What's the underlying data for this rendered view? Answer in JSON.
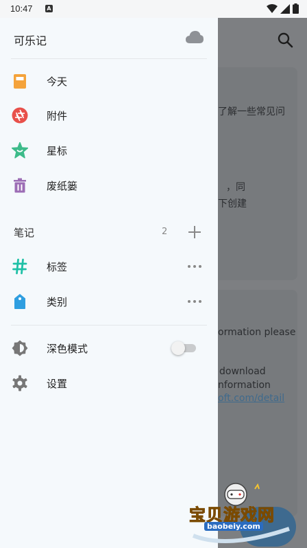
{
  "status_bar": {
    "time": "10:47"
  },
  "drawer": {
    "title": "可乐记",
    "main_items": [
      {
        "label": "今天",
        "icon": "calendar-icon",
        "color": "#f4a33b"
      },
      {
        "label": "附件",
        "icon": "aperture-icon",
        "color": "#e8504a"
      },
      {
        "label": "星标",
        "icon": "star-icon",
        "color": "#3dbb8a"
      },
      {
        "label": "废纸篓",
        "icon": "trash-icon",
        "color": "#9c6db5"
      }
    ],
    "notes_section": {
      "label": "笔记",
      "count": "2"
    },
    "note_items": [
      {
        "label": "标签",
        "icon": "hashtag-icon",
        "color": "#1fc0a6"
      },
      {
        "label": "类别",
        "icon": "tag-icon",
        "color": "#2f9ee0"
      }
    ],
    "dark_mode": {
      "label": "深色模式",
      "enabled": false
    },
    "settings": {
      "label": "设置"
    }
  },
  "background": {
    "card1_lines": [
      "了解一些常见问",
      "，同",
      "下创建"
    ],
    "card2_lines": [
      "ormation please",
      "download",
      "nformation",
      "oft.com/detail"
    ]
  },
  "watermark": {
    "brand": "宝贝游戏网",
    "url": "baobeiy.com"
  }
}
